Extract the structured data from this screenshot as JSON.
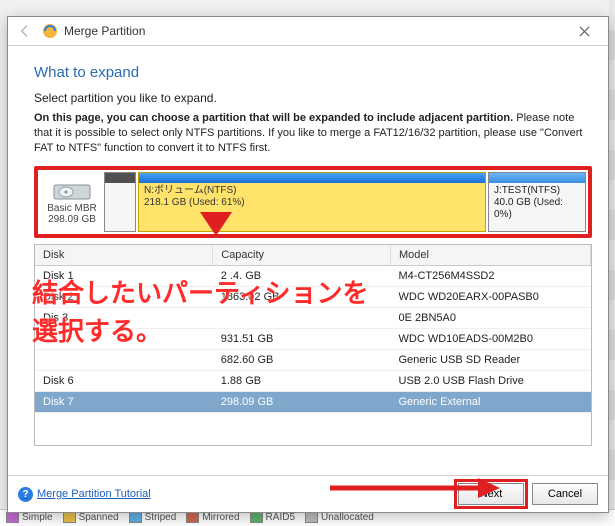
{
  "titlebar": {
    "title": "Merge Partition"
  },
  "heading": "What to expand",
  "intro": "Select partition you like to expand.",
  "note_bold": "On this page, you can choose a partition that will be expanded to include adjacent partition.",
  "note_rest": " Please note that it is possible to select only NTFS partitions. If you like to merge a FAT12/16/32 partition, please use \"Convert FAT to NTFS\" function to convert it to NTFS first.",
  "diskmap": {
    "thumb_line1": "Basic MBR",
    "thumb_line2": "298.09 GB",
    "selected_label_line1": "N:ボリューム(NTFS)",
    "selected_label_line2": "218.1 GB (Used: 61%)",
    "other_label_line1": "J:TEST(NTFS)",
    "other_label_line2": "40.0 GB (Used: 0%)"
  },
  "table": {
    "headers": {
      "disk": "Disk",
      "capacity": "Capacity",
      "model": "Model"
    },
    "rows": [
      {
        "disk": "Disk 1",
        "capacity": "2 .4. GB",
        "model": "M4-CT256M4SSD2"
      },
      {
        "disk": "Disk 2",
        "capacity": "1863.02 GB",
        "model": "WDC WD20EARX-00PASB0"
      },
      {
        "disk": "Dis 3",
        "capacity": "",
        "model": "0E             2BN5A0"
      },
      {
        "disk": "",
        "capacity": "931.51 GB",
        "model": "WDC WD10EADS-00M2B0"
      },
      {
        "disk": "",
        "capacity": "682.60 GB",
        "model": "Generic USB SD Reader"
      },
      {
        "disk": "Disk 6",
        "capacity": "1.88 GB",
        "model": "USB 2.0 USB Flash Drive"
      },
      {
        "disk": "Disk 7",
        "capacity": "298.09 GB",
        "model": "Generic External"
      }
    ],
    "selected_index": 6
  },
  "annotation": {
    "line1": "結合したいパーティションを",
    "line2": "選択する。"
  },
  "footer": {
    "help_link": "Merge Partition Tutorial",
    "next": "Next",
    "cancel": "Cancel"
  },
  "legend": {
    "items": [
      "Simple",
      "Spanned",
      "Striped",
      "Mirrored",
      "RAID5",
      "Unallocated"
    ]
  }
}
